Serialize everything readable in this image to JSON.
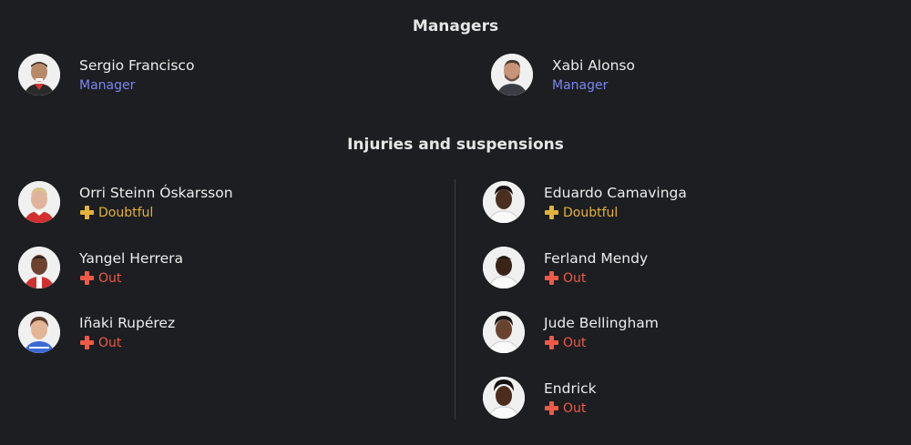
{
  "managers": {
    "title": "Managers",
    "items": [
      {
        "name": "Sergio Francisco",
        "role": "Manager"
      },
      {
        "name": "Xabi Alonso",
        "role": "Manager"
      }
    ]
  },
  "injuries": {
    "title": "Injuries and suspensions",
    "home": [
      {
        "name": "Orri Steinn Óskarsson",
        "status": "Doubtful"
      },
      {
        "name": "Yangel Herrera",
        "status": "Out"
      },
      {
        "name": "Iñaki Rupérez",
        "status": "Out"
      }
    ],
    "away": [
      {
        "name": "Eduardo Camavinga",
        "status": "Doubtful"
      },
      {
        "name": "Ferland Mendy",
        "status": "Out"
      },
      {
        "name": "Jude Bellingham",
        "status": "Out"
      },
      {
        "name": "Endrick",
        "status": "Out"
      }
    ]
  },
  "colors": {
    "background": "#1c1e21",
    "manager_role": "#7b86f0",
    "doubtful": "#e4b33b",
    "out": "#ef5a47"
  },
  "icons": {
    "status": "medical-cross-icon",
    "avatar": "player-photo"
  }
}
